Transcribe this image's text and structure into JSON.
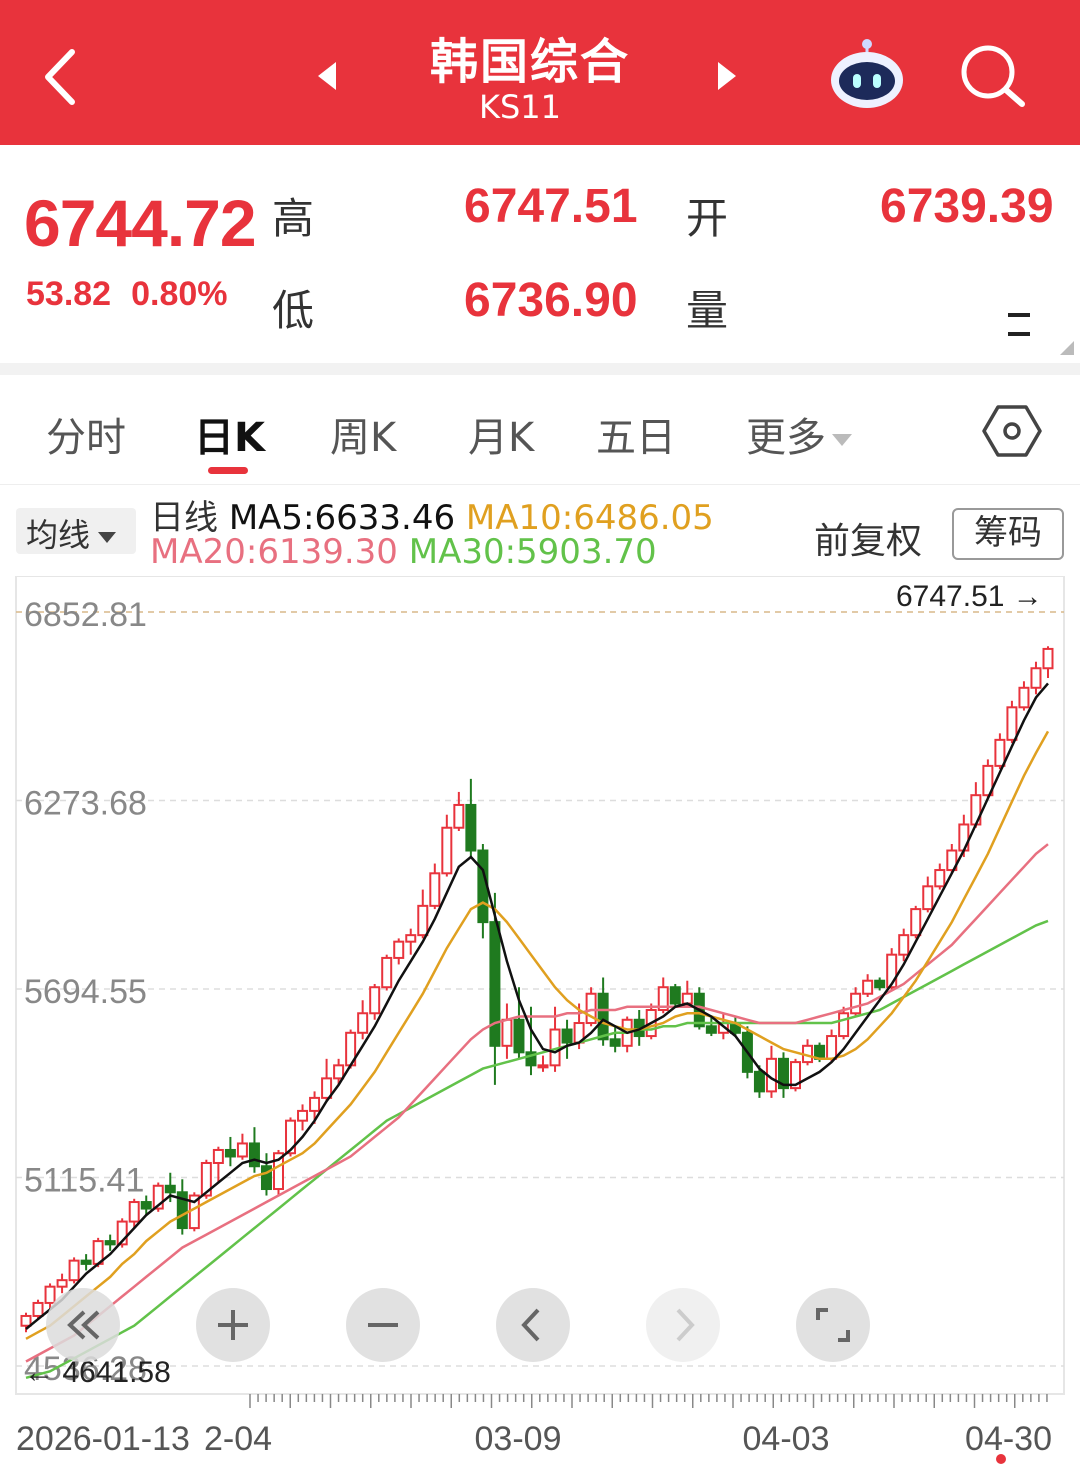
{
  "header": {
    "title": "韩国综合",
    "code": "KS11",
    "back_icon": "chevron-left-icon",
    "prev_icon": "triangle-left-icon",
    "next_icon": "triangle-right-icon",
    "bot_icon": "robot-assistant-icon",
    "search_icon": "search-icon"
  },
  "quote": {
    "price": "6744.72",
    "change": "53.82",
    "change_pct": "0.80%",
    "high_label": "高",
    "high": "6747.51",
    "open_label": "开",
    "open": "6739.39",
    "low_label": "低",
    "low": "6736.90",
    "volume_label": "量",
    "volume": "--"
  },
  "tabs": [
    {
      "label": "分时"
    },
    {
      "label": "日K",
      "active": true
    },
    {
      "label": "周K"
    },
    {
      "label": "月K"
    },
    {
      "label": "五日"
    },
    {
      "label": "更多"
    }
  ],
  "ma": {
    "select_label": "均线",
    "period_label": "日线",
    "ma5": "MA5:6633.46",
    "ma10": "MA10:6486.05",
    "ma20": "MA20:6139.30",
    "ma30": "MA30:5903.70",
    "adjust_label": "前复权",
    "chip_label": "筹码"
  },
  "colors": {
    "up": "#e8333c",
    "down": "#1f7a1f",
    "ma5": "#111111",
    "ma10": "#e0a020",
    "ma20": "#e87080",
    "ma30": "#62c24a"
  },
  "chart_data": {
    "type": "candlestick",
    "y_ticks": [
      "6852.81",
      "6273.68",
      "5694.55",
      "5115.41",
      "4536.28"
    ],
    "x_ticks": [
      "2026-01-13",
      "2-04",
      "03-09",
      "04-03",
      "04-30"
    ],
    "ylim": [
      4536.28,
      6852.81
    ],
    "max_label": "6747.51",
    "min_label": "4641.58",
    "candles": [
      [
        4660,
        4690,
        4640,
        4700
      ],
      [
        4690,
        4730,
        4680,
        4740
      ],
      [
        4730,
        4780,
        4710,
        4790
      ],
      [
        4780,
        4800,
        4760,
        4820
      ],
      [
        4800,
        4860,
        4790,
        4870
      ],
      [
        4860,
        4850,
        4830,
        4880
      ],
      [
        4850,
        4920,
        4840,
        4930
      ],
      [
        4920,
        4910,
        4890,
        4940
      ],
      [
        4910,
        4980,
        4900,
        4990
      ],
      [
        4980,
        5040,
        4960,
        5050
      ],
      [
        5040,
        5020,
        5000,
        5060
      ],
      [
        5020,
        5090,
        5010,
        5100
      ],
      [
        5090,
        5070,
        5040,
        5130
      ],
      [
        5070,
        4960,
        4940,
        5110
      ],
      [
        4960,
        5060,
        4950,
        5070
      ],
      [
        5060,
        5160,
        5050,
        5170
      ],
      [
        5160,
        5200,
        5100,
        5210
      ],
      [
        5200,
        5180,
        5150,
        5240
      ],
      [
        5180,
        5220,
        5170,
        5250
      ],
      [
        5220,
        5150,
        5130,
        5270
      ],
      [
        5150,
        5080,
        5060,
        5190
      ],
      [
        5080,
        5190,
        5060,
        5200
      ],
      [
        5190,
        5290,
        5180,
        5300
      ],
      [
        5290,
        5320,
        5260,
        5340
      ],
      [
        5320,
        5360,
        5280,
        5380
      ],
      [
        5360,
        5420,
        5350,
        5480
      ],
      [
        5420,
        5460,
        5400,
        5480
      ],
      [
        5460,
        5560,
        5450,
        5570
      ],
      [
        5560,
        5620,
        5540,
        5660
      ],
      [
        5620,
        5700,
        5600,
        5710
      ],
      [
        5700,
        5790,
        5690,
        5800
      ],
      [
        5790,
        5840,
        5770,
        5850
      ],
      [
        5840,
        5860,
        5800,
        5880
      ],
      [
        5860,
        5950,
        5850,
        6000
      ],
      [
        5950,
        6050,
        5940,
        6080
      ],
      [
        6050,
        6190,
        6040,
        6230
      ],
      [
        6190,
        6260,
        6180,
        6300
      ],
      [
        6260,
        6120,
        6100,
        6340
      ],
      [
        6120,
        5900,
        5850,
        6140
      ],
      [
        5900,
        5520,
        5400,
        5990
      ],
      [
        5520,
        5600,
        5480,
        5650
      ],
      [
        5600,
        5500,
        5480,
        5700
      ],
      [
        5500,
        5460,
        5430,
        5640
      ],
      [
        5460,
        5460,
        5440,
        5490
      ],
      [
        5460,
        5570,
        5440,
        5640
      ],
      [
        5570,
        5530,
        5480,
        5600
      ],
      [
        5530,
        5590,
        5510,
        5650
      ],
      [
        5590,
        5680,
        5580,
        5700
      ],
      [
        5680,
        5540,
        5520,
        5730
      ],
      [
        5540,
        5520,
        5500,
        5580
      ],
      [
        5520,
        5600,
        5500,
        5610
      ],
      [
        5600,
        5550,
        5520,
        5630
      ],
      [
        5550,
        5630,
        5540,
        5650
      ],
      [
        5630,
        5700,
        5620,
        5730
      ],
      [
        5700,
        5650,
        5640,
        5710
      ],
      [
        5650,
        5680,
        5640,
        5720
      ],
      [
        5680,
        5580,
        5570,
        5700
      ],
      [
        5580,
        5560,
        5550,
        5610
      ],
      [
        5560,
        5590,
        5540,
        5620
      ],
      [
        5590,
        5560,
        5550,
        5610
      ],
      [
        5560,
        5440,
        5420,
        5580
      ],
      [
        5440,
        5380,
        5360,
        5460
      ],
      [
        5380,
        5480,
        5360,
        5520
      ],
      [
        5480,
        5390,
        5360,
        5500
      ],
      [
        5390,
        5470,
        5380,
        5480
      ],
      [
        5470,
        5520,
        5460,
        5540
      ],
      [
        5520,
        5480,
        5470,
        5530
      ],
      [
        5480,
        5550,
        5470,
        5570
      ],
      [
        5550,
        5620,
        5540,
        5640
      ],
      [
        5620,
        5680,
        5610,
        5700
      ],
      [
        5680,
        5720,
        5670,
        5740
      ],
      [
        5720,
        5700,
        5690,
        5730
      ],
      [
        5700,
        5800,
        5690,
        5820
      ],
      [
        5800,
        5860,
        5780,
        5880
      ],
      [
        5860,
        5940,
        5850,
        5950
      ],
      [
        5940,
        6010,
        5930,
        6040
      ],
      [
        6010,
        6060,
        6000,
        6080
      ],
      [
        6060,
        6120,
        6050,
        6140
      ],
      [
        6120,
        6200,
        6100,
        6230
      ],
      [
        6200,
        6290,
        6190,
        6330
      ],
      [
        6290,
        6380,
        6280,
        6400
      ],
      [
        6380,
        6460,
        6370,
        6480
      ],
      [
        6460,
        6560,
        6450,
        6580
      ],
      [
        6560,
        6620,
        6550,
        6640
      ],
      [
        6620,
        6680,
        6600,
        6700
      ],
      [
        6680,
        6739.39,
        6650,
        6747.51
      ]
    ],
    "ma5": [
      4650,
      4680,
      4710,
      4740,
      4780,
      4820,
      4850,
      4880,
      4920,
      4960,
      5000,
      5030,
      5060,
      5050,
      5040,
      5070,
      5100,
      5130,
      5160,
      5170,
      5160,
      5170,
      5200,
      5240,
      5290,
      5350,
      5400,
      5460,
      5520,
      5580,
      5650,
      5720,
      5780,
      5840,
      5910,
      5990,
      6070,
      6100,
      6060,
      5920,
      5780,
      5660,
      5570,
      5510,
      5500,
      5520,
      5530,
      5560,
      5600,
      5580,
      5560,
      5570,
      5590,
      5610,
      5640,
      5650,
      5630,
      5610,
      5580,
      5550,
      5500,
      5450,
      5420,
      5400,
      5400,
      5420,
      5440,
      5470,
      5510,
      5560,
      5610,
      5660,
      5710,
      5770,
      5840,
      5910,
      5980,
      6050,
      6120,
      6200,
      6280,
      6360,
      6440,
      6520,
      6590,
      6633.46
    ],
    "ma10": [
      4620,
      4640,
      4660,
      4690,
      4720,
      4750,
      4780,
      4810,
      4850,
      4880,
      4920,
      4950,
      4980,
      5000,
      5020,
      5040,
      5060,
      5080,
      5100,
      5120,
      5130,
      5150,
      5170,
      5190,
      5220,
      5260,
      5300,
      5340,
      5390,
      5440,
      5500,
      5560,
      5620,
      5680,
      5750,
      5820,
      5880,
      5940,
      5960,
      5940,
      5900,
      5850,
      5800,
      5750,
      5700,
      5660,
      5630,
      5610,
      5590,
      5580,
      5570,
      5570,
      5580,
      5590,
      5610,
      5620,
      5620,
      5610,
      5600,
      5590,
      5570,
      5550,
      5530,
      5510,
      5500,
      5490,
      5480,
      5480,
      5490,
      5510,
      5540,
      5580,
      5620,
      5670,
      5720,
      5780,
      5840,
      5900,
      5970,
      6040,
      6110,
      6190,
      6270,
      6350,
      6420,
      6486.05
    ],
    "ma20": [
      4550,
      4570,
      4590,
      4610,
      4630,
      4660,
      4690,
      4720,
      4750,
      4780,
      4810,
      4840,
      4870,
      4900,
      4920,
      4940,
      4960,
      4980,
      5000,
      5020,
      5040,
      5060,
      5080,
      5100,
      5120,
      5140,
      5160,
      5180,
      5210,
      5240,
      5270,
      5300,
      5340,
      5380,
      5420,
      5460,
      5500,
      5540,
      5570,
      5590,
      5600,
      5610,
      5610,
      5610,
      5610,
      5620,
      5620,
      5630,
      5630,
      5630,
      5640,
      5640,
      5640,
      5640,
      5640,
      5640,
      5640,
      5630,
      5620,
      5610,
      5600,
      5590,
      5590,
      5590,
      5590,
      5600,
      5610,
      5620,
      5630,
      5640,
      5650,
      5670,
      5690,
      5710,
      5740,
      5770,
      5800,
      5830,
      5870,
      5910,
      5950,
      5990,
      6030,
      6070,
      6110,
      6139.3
    ],
    "ma30": [
      4500,
      4510,
      4520,
      4540,
      4560,
      4580,
      4600,
      4620,
      4640,
      4660,
      4690,
      4720,
      4750,
      4780,
      4810,
      4840,
      4870,
      4900,
      4930,
      4960,
      4990,
      5020,
      5050,
      5080,
      5110,
      5140,
      5170,
      5200,
      5230,
      5260,
      5290,
      5310,
      5330,
      5350,
      5370,
      5390,
      5410,
      5430,
      5450,
      5460,
      5470,
      5480,
      5490,
      5500,
      5510,
      5520,
      5530,
      5540,
      5550,
      5560,
      5560,
      5570,
      5570,
      5580,
      5580,
      5590,
      5590,
      5590,
      5590,
      5590,
      5590,
      5590,
      5590,
      5590,
      5590,
      5590,
      5590,
      5590,
      5600,
      5610,
      5620,
      5630,
      5650,
      5670,
      5690,
      5710,
      5730,
      5750,
      5770,
      5790,
      5810,
      5830,
      5850,
      5870,
      5890,
      5903.7
    ]
  },
  "controls": [
    {
      "name": "zoom-out-history-icon"
    },
    {
      "name": "zoom-in-icon"
    },
    {
      "name": "zoom-minus-icon"
    },
    {
      "name": "scroll-left-icon"
    },
    {
      "name": "scroll-right-icon"
    },
    {
      "name": "fullscreen-icon"
    }
  ]
}
